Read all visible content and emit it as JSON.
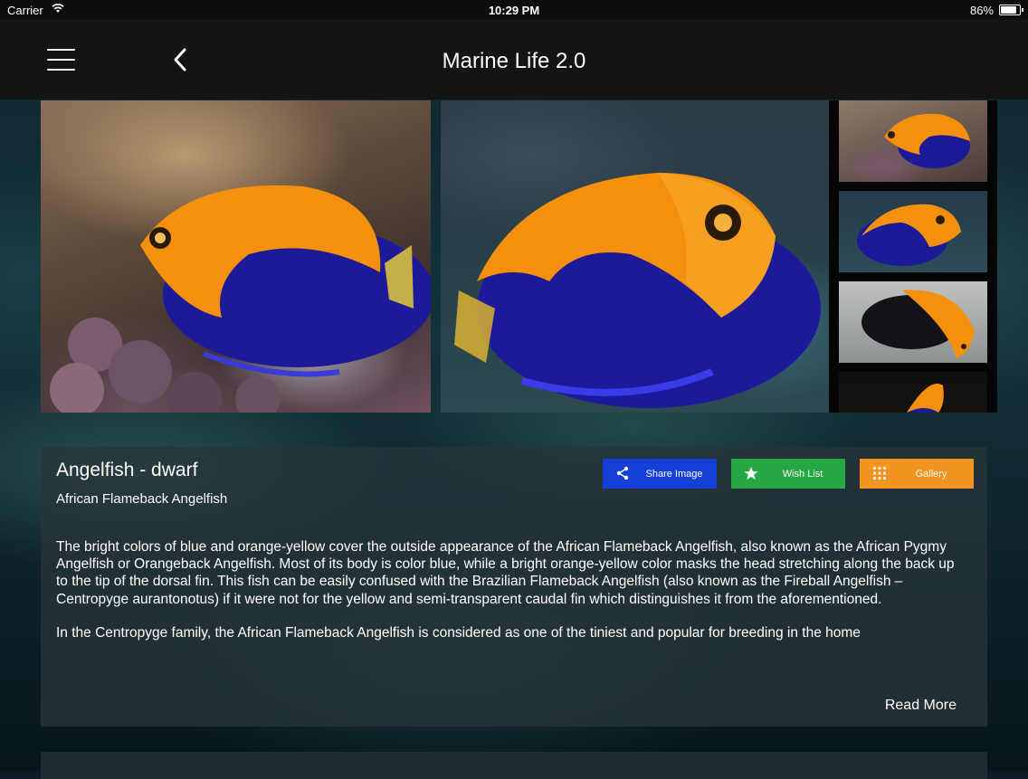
{
  "status_bar": {
    "carrier": "Carrier",
    "time": "10:29 PM",
    "battery": "86%",
    "battery_level": 0.86
  },
  "navbar": {
    "title": "Marine Life 2.0",
    "menu_icon": "hamburger-menu-icon",
    "back_icon": "chevron-left-icon"
  },
  "species": {
    "name": "Angelfish - dwarf",
    "common_name": "African Flameback Angelfish",
    "description": [
      "The bright colors of blue and orange-yellow cover the outside appearance of the African Flameback Angelfish, also known as the African Pygmy Angelfish or Orangeback Angelfish. Most of its body is color blue, while a bright orange-yellow color masks the head stretching along the back up to the tip of the dorsal fin. This fish can be easily confused with the Brazilian Flameback Angelfish (also known as the Fireball Angelfish – Centropyge aurantonotus) if it were not for the yellow and semi-transparent caudal fin which distinguishes it from the aforementioned.",
      "In the Centropyge family, the African Flameback Angelfish is considered as one of the tiniest and popular for breeding in the home"
    ],
    "read_more": "Read More"
  },
  "actions": {
    "share": {
      "label": "Share Image",
      "icon": "share-icon",
      "color": "#1540d8"
    },
    "wishlist": {
      "label": "Wish List",
      "icon": "star-icon",
      "color": "#28a745"
    },
    "gallery": {
      "label": "Gallery",
      "icon": "grid-icon",
      "color": "#f29422"
    }
  },
  "colors": {
    "fish_orange": "#f5900f",
    "fish_blue": "#1d1a9a"
  }
}
